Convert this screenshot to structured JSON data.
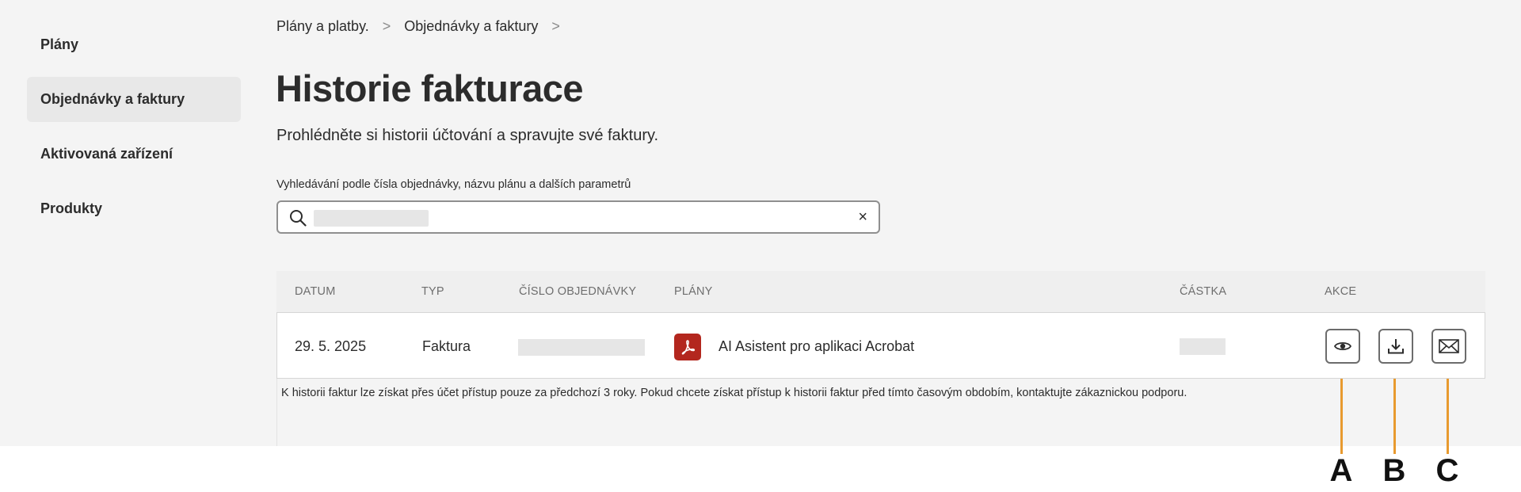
{
  "sidebar": {
    "items": [
      {
        "label": "Plány",
        "active": false
      },
      {
        "label": "Objednávky a faktury",
        "active": true
      },
      {
        "label": "Aktivovaná zařízení",
        "active": false
      },
      {
        "label": "Produkty",
        "active": false
      }
    ]
  },
  "breadcrumb": {
    "items": [
      "Plány a platby.",
      "Objednávky a faktury"
    ],
    "separator": ">"
  },
  "page": {
    "title": "Historie fakturace",
    "subtitle": "Prohlédněte si historii účtování a spravujte své faktury."
  },
  "search": {
    "label": "Vyhledávání podle čísla objednávky, názvu plánu a dalších parametrů",
    "clear": "×"
  },
  "table": {
    "headers": {
      "date": "DATUM",
      "type": "TYP",
      "order": "ČÍSLO OBJEDNÁVKY",
      "plans": "PLÁNY",
      "amount": "ČÁSTKA",
      "actions": "AKCE"
    },
    "rows": [
      {
        "date": "29. 5. 2025",
        "type": "Faktura",
        "plan": "AI Asistent pro aplikaci Acrobat"
      }
    ],
    "footnote": "K historii faktur lze získat přes účet přístup pouze za předchozí 3 roky. Pokud chcete získat přístup k historii faktur před tímto časovým obdobím, kontaktujte zákaznickou podporu."
  },
  "callouts": {
    "a": "A",
    "b": "B",
    "c": "C"
  },
  "icons": {
    "pdf": "acrobat-pdf-icon",
    "view": "eye-icon",
    "download": "download-icon",
    "email": "envelope-icon"
  },
  "colors": {
    "background": "#f4f4f4",
    "pdf_red": "#b3271e",
    "callout_orange": "#e89a2f"
  }
}
